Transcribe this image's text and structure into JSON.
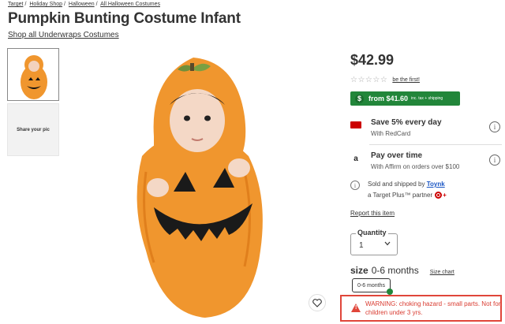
{
  "breadcrumb": [
    "Target",
    "Holiday Shop",
    "Halloween",
    "All Halloween Costumes"
  ],
  "title": "Pumpkin Bunting Costume Infant",
  "shop_link": "Shop all Underwraps Costumes",
  "share_label": "Share your pic",
  "price": "$42.99",
  "rating": {
    "stars": "☆☆☆☆☆",
    "link": "be the first!"
  },
  "deal": {
    "icon": "$",
    "text": "from $41.60",
    "sub": "inc. tax + shipping"
  },
  "perks": [
    {
      "icon": "redcard-icon",
      "heading": "Save 5% every day",
      "sub": "With RedCard"
    },
    {
      "icon": "affirm-icon",
      "glyph": "a",
      "heading": "Pay over time",
      "sub": "With Affirm on orders over $100"
    }
  ],
  "seller": {
    "prefix": "Sold and shipped by",
    "name": "Toynk",
    "partner": "a Target Plus™ partner"
  },
  "report_link": "Report this item",
  "quantity": {
    "label": "Quantity",
    "value": "1"
  },
  "size": {
    "label": "size",
    "value": "0-6 months",
    "chart_link": "Size chart",
    "option": "0-6 months"
  },
  "warning": "WARNING: choking hazard - small parts. Not for children under 3 yrs.",
  "colors": {
    "deal_green": "#22863a",
    "warning_red": "#e0463a",
    "redcard": "#cc0000",
    "pumpkin": "#f0962e"
  }
}
